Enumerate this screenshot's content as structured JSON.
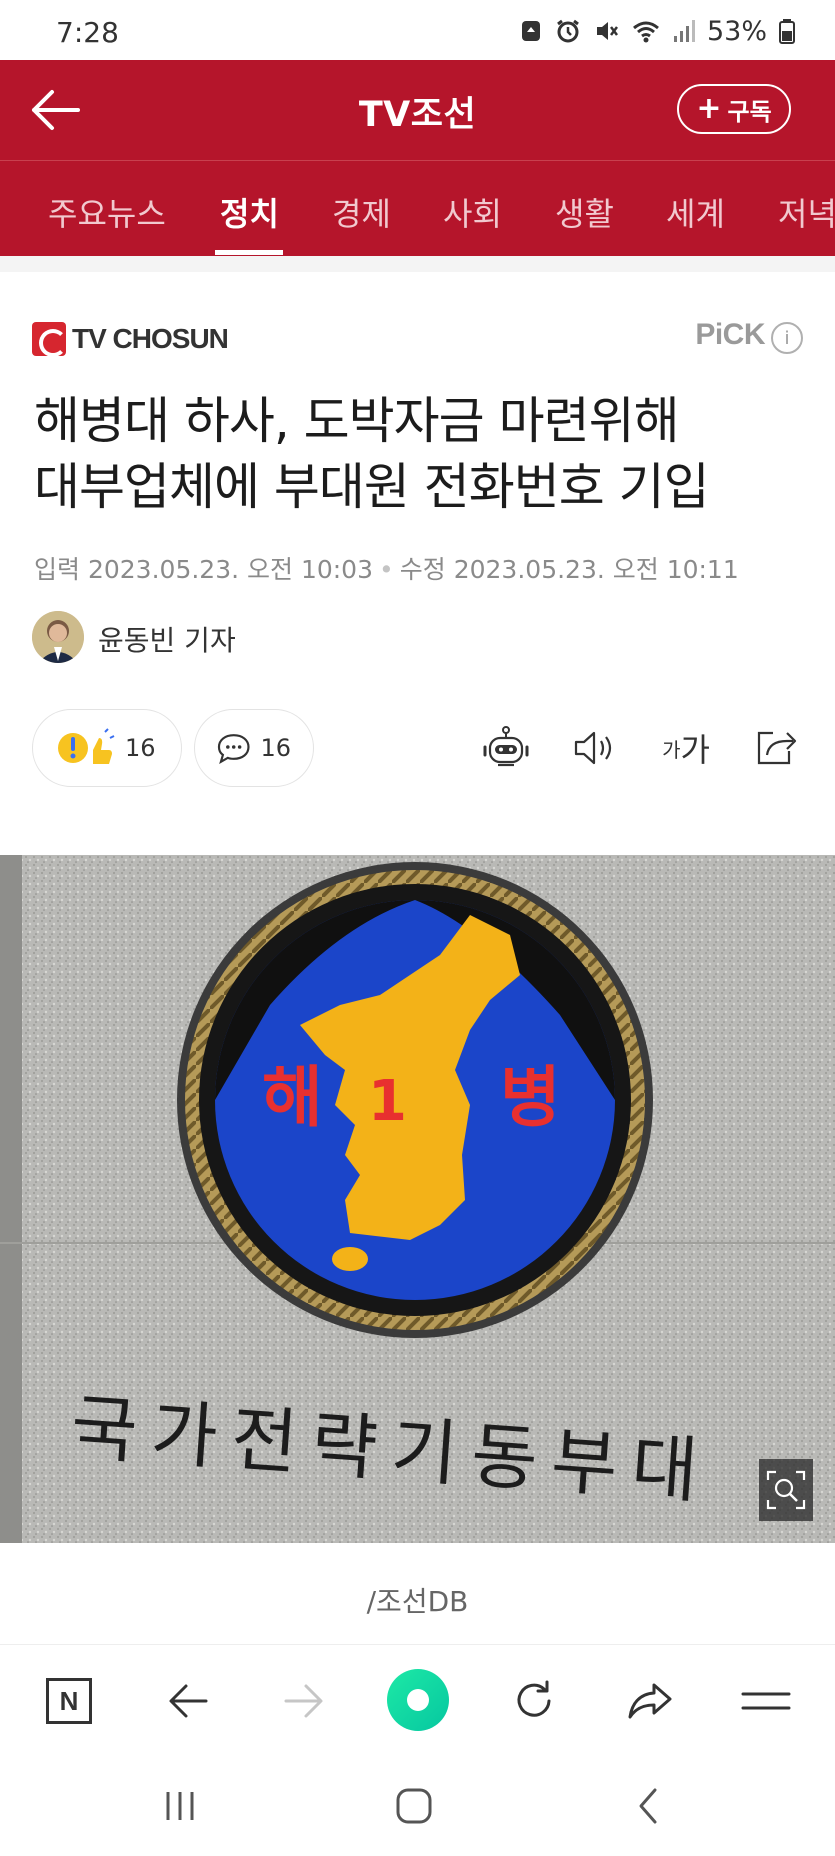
{
  "status_bar": {
    "time": "7:28",
    "battery": "53%"
  },
  "header": {
    "title": "TV조선",
    "subscribe_label": "구독",
    "subscribe_prefix": "+"
  },
  "tabs": [
    {
      "label": "주요뉴스",
      "active": false
    },
    {
      "label": "정치",
      "active": true
    },
    {
      "label": "경제",
      "active": false
    },
    {
      "label": "사회",
      "active": false
    },
    {
      "label": "생활",
      "active": false
    },
    {
      "label": "세계",
      "active": false
    },
    {
      "label": "저녁",
      "active": false
    }
  ],
  "article": {
    "source_logo": "TV CHOSUN",
    "pick_label": "PiCK",
    "info_label": "i",
    "headline_line1": "해병대 하사, 도박자금 마련위해",
    "headline_line2": "대부업체에 부대원 전화번호 기입",
    "input_label": "입력",
    "input_date": "2023.05.23. 오전 10:03",
    "edit_label": "수정",
    "edit_date": "2023.05.23. 오전 10:11",
    "reporter": "윤동빈 기자",
    "reaction_count": "16",
    "comment_count": "16",
    "font_size_small": "가",
    "font_size_large": "가",
    "photo_text": {
      "char_left": "해",
      "char_center": "1",
      "char_right": "병",
      "engraving": "국가전략기동부대"
    },
    "caption": "/조선DB"
  },
  "colors": {
    "brand_red": "#b5152b",
    "emblem_blue": "#1b45c9",
    "emblem_yellow": "#f3b218",
    "accent_green": "#06c7a0"
  },
  "icons": {
    "header": [
      "back-arrow-icon"
    ],
    "reactions": [
      "surprise-emoji-icon",
      "thumbs-up-emoji-icon",
      "comment-icon"
    ],
    "tools": [
      "robot-summary-icon",
      "speaker-icon",
      "share-icon"
    ],
    "browser": [
      "naver-n-icon",
      "back-icon",
      "forward-icon",
      "green-home-icon",
      "refresh-icon",
      "share-arrow-icon",
      "menu-icon"
    ],
    "nav": [
      "recent-apps-icon",
      "home-icon",
      "back-nav-icon"
    ]
  }
}
